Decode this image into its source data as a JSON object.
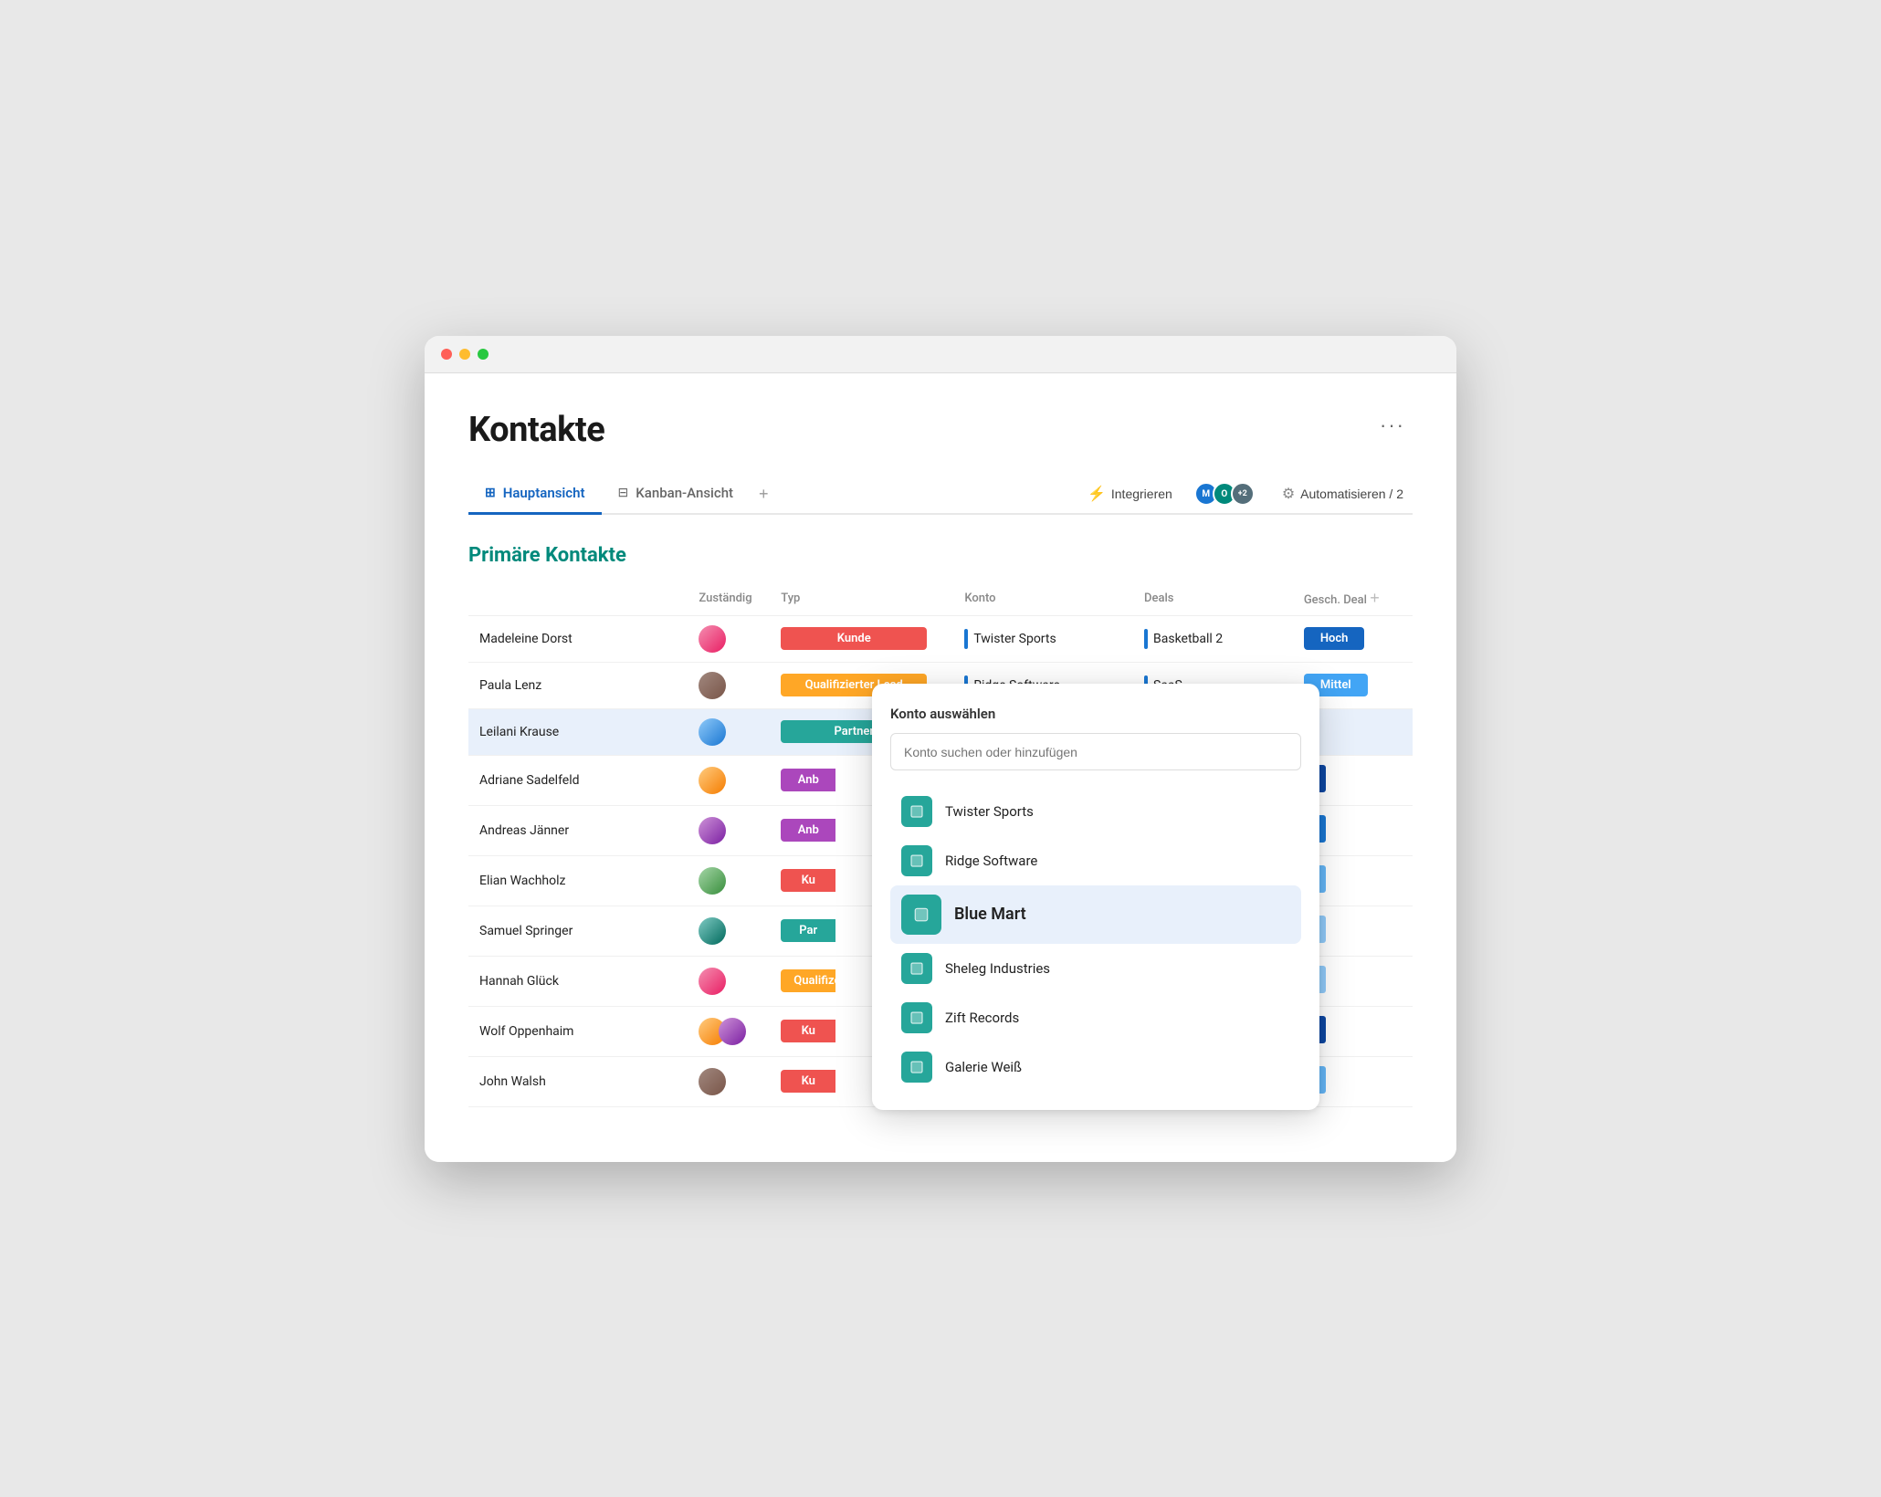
{
  "window": {
    "title": "Kontakte"
  },
  "header": {
    "title": "Kontakte",
    "more_label": "···"
  },
  "tabs": {
    "items": [
      {
        "id": "main",
        "label": "Hauptansicht",
        "icon": "⊞",
        "active": true
      },
      {
        "id": "kanban",
        "label": "Kanban-Ansicht",
        "icon": "⊟",
        "active": false
      }
    ],
    "add_label": "+",
    "integrate_label": "Integrieren",
    "automate_label": "Automatisieren / 2"
  },
  "section": {
    "title": "Primäre Kontakte",
    "columns": [
      "Zuständig",
      "Typ",
      "Konto",
      "Deals",
      "Gesch. Deal"
    ]
  },
  "contacts": [
    {
      "name": "Madeleine Dorst",
      "avatar_class": "av-pink",
      "type": "Kunde",
      "type_class": "type-kunde",
      "konto": "Twister Sports",
      "deals": "Basketball 2",
      "deal_class": "deal-hoch",
      "deal_label": "Hoch"
    },
    {
      "name": "Paula Lenz",
      "avatar_class": "av-brown",
      "type": "Qualifizierter Lead",
      "type_class": "type-lead",
      "konto": "Ridge Software",
      "deals": "SaaS",
      "deal_class": "deal-mittel",
      "deal_label": "Mittel"
    },
    {
      "name": "Leilani Krause",
      "avatar_class": "av-blue",
      "type": "Partner",
      "type_class": "type-partner",
      "konto": "",
      "deals": "",
      "deal_class": "",
      "deal_label": "",
      "highlighted": true
    },
    {
      "name": "Adriane Sadelfeld",
      "avatar_class": "av-orange",
      "type": "Anb",
      "type_class": "type-anbieter",
      "konto": "",
      "deals": "",
      "deal_class": "deal-dark deal-small",
      "deal_label": ""
    },
    {
      "name": "Andreas Jänner",
      "avatar_class": "av-purple",
      "type": "Anb",
      "type_class": "type-anbieter",
      "konto": "",
      "deals": "",
      "deal_class": "deal-med deal-small",
      "deal_label": ""
    },
    {
      "name": "Elian Wachholz",
      "avatar_class": "av-green",
      "type": "Ku",
      "type_class": "type-kunde",
      "konto": "",
      "deals": "",
      "deal_class": "deal-light deal-small",
      "deal_label": ""
    },
    {
      "name": "Samuel Springer",
      "avatar_class": "av-teal",
      "type": "Par",
      "type_class": "type-partner",
      "konto": "",
      "deals": "",
      "deal_class": "deal-lighter deal-small",
      "deal_label": ""
    },
    {
      "name": "Hannah Glück",
      "avatar_class": "av-pink",
      "type": "Qualifize",
      "type_class": "type-lead",
      "konto": "",
      "deals": "",
      "deal_class": "deal-lighter deal-small",
      "deal_label": ""
    },
    {
      "name": "Wolf Oppenhaim",
      "avatar_class": "av-multi",
      "type": "Ku",
      "type_class": "type-kunde",
      "konto": "",
      "deals": "",
      "deal_class": "deal-dark deal-small",
      "deal_label": ""
    },
    {
      "name": "John Walsh",
      "avatar_class": "av-brown",
      "type": "Ku",
      "type_class": "type-kunde",
      "konto": "",
      "deals": "",
      "deal_class": "deal-light deal-small",
      "deal_label": ""
    }
  ],
  "dropdown": {
    "title": "Konto auswählen",
    "search_placeholder": "Konto suchen oder hinzufügen",
    "items": [
      {
        "name": "Twister Sports",
        "selected": false
      },
      {
        "name": "Ridge Software",
        "selected": false
      },
      {
        "name": "Blue Mart",
        "selected": true
      },
      {
        "name": "Sheleg Industries",
        "selected": false
      },
      {
        "name": "Zift Records",
        "selected": false
      },
      {
        "name": "Galerie Weiß",
        "selected": false
      }
    ]
  }
}
